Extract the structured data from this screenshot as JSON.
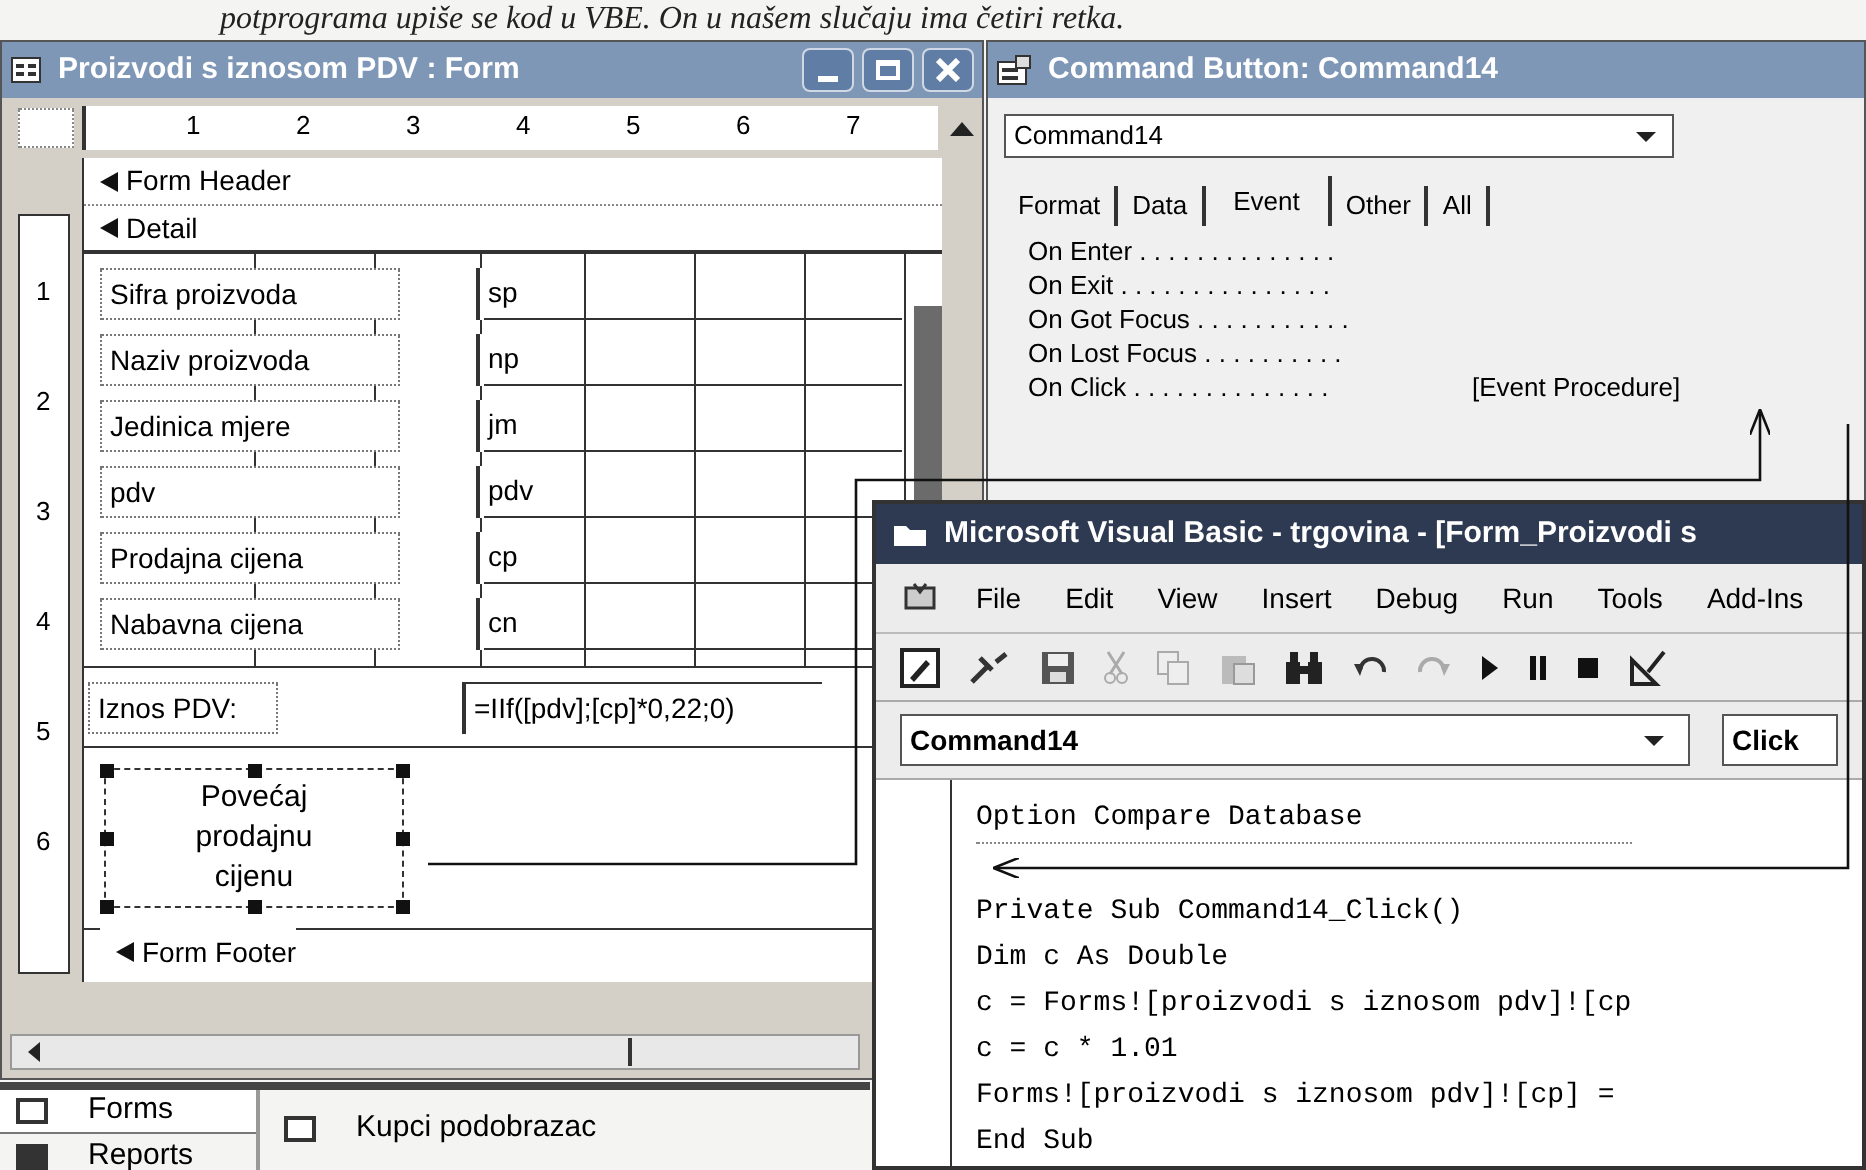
{
  "book_text": "potprograma upiše se kod u VBE. On u našem slučaju ima četiri retka.",
  "form_window": {
    "title": "Proizvodi s iznosom PDV : Form",
    "ruler_numbers": [
      "1",
      "2",
      "3",
      "4",
      "5",
      "6",
      "7"
    ],
    "vertical_ruler_numbers": [
      "1",
      "2",
      "3",
      "4",
      "5",
      "6"
    ],
    "sections": [
      "Form Header",
      "Detail"
    ],
    "fields": [
      {
        "label": "Sifra proizvoda",
        "control": "sp"
      },
      {
        "label": "Naziv proizvoda",
        "control": "np"
      },
      {
        "label": "Jedinica mjere",
        "control": "jm"
      },
      {
        "label": "pdv",
        "control": "pdv"
      },
      {
        "label": "Prodajna cijena",
        "control": "cp"
      },
      {
        "label": "Nabavna cijena",
        "control": "cn"
      }
    ],
    "calculated": {
      "label": "Iznos PDV:",
      "expression": "=IIf([pdv];[cp]*0,22;0)"
    },
    "button": {
      "caption": "Povećaj prodajnu cijenu",
      "selected": true
    },
    "footer_section": "Form Footer"
  },
  "database_window": {
    "groups": [
      {
        "label": "Forms",
        "selected": true
      },
      {
        "label": "Reports",
        "selected": false
      }
    ],
    "objects": [
      "Kupci podobrazac"
    ]
  },
  "properties_window": {
    "title": "Command Button: Command14",
    "object": "Command14",
    "tabs": [
      {
        "label": "Format",
        "selected": false
      },
      {
        "label": "Data",
        "selected": false
      },
      {
        "label": "Event",
        "selected": true
      },
      {
        "label": "Other",
        "selected": false
      },
      {
        "label": "All",
        "selected": false
      }
    ],
    "properties": [
      {
        "name": "On Enter . . . . . . . . . . . . . ."
      },
      {
        "name": "On Exit . . . . . . . . . . . . . . ."
      },
      {
        "name": "On Got Focus . . . . . . . . . . ."
      },
      {
        "name": "On Lost Focus . . . . . . . . . ."
      },
      {
        "name": "On Click . . . . . . . . . . . . . .",
        "value": "[Event Procedure]"
      }
    ]
  },
  "vb_window": {
    "title": "Microsoft Visual Basic - trgovina - [Form_Proizvodi s",
    "menu": [
      "File",
      "Edit",
      "View",
      "Insert",
      "Debug",
      "Run",
      "Tools",
      "Add-Ins"
    ],
    "object_combo": "Command14",
    "procedure_combo": "Click",
    "code_lines": [
      {
        "text": "Option Compare Database",
        "separator_after": true
      },
      {
        "text": "Private Sub Command14_Click()",
        "separator_after": false
      },
      {
        "text": "Dim c As Double",
        "separator_after": false
      },
      {
        "text": "c = Forms![proizvodi s iznosom pdv]![cp",
        "separator_after": false
      },
      {
        "text": "c = c * 1.01",
        "separator_after": false
      },
      {
        "text": "Forms![proizvodi s iznosom pdv]![cp] =",
        "separator_after": false
      },
      {
        "text": "End Sub",
        "separator_after": false
      }
    ]
  }
}
